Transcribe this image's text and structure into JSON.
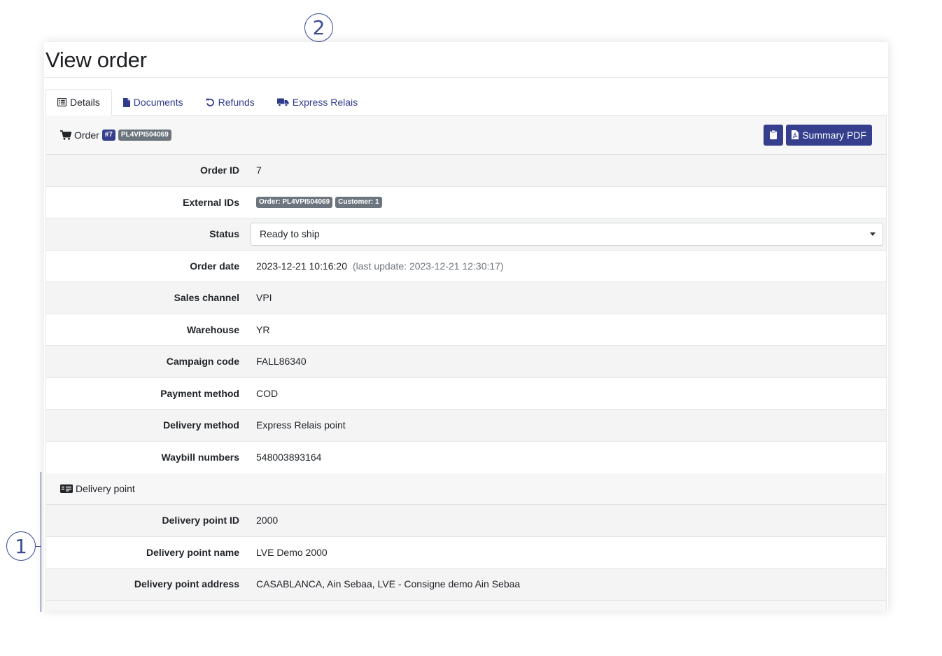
{
  "page": {
    "title": "View order"
  },
  "callouts": {
    "one": "1",
    "two": "2"
  },
  "tabs": [
    {
      "label": "Details",
      "icon": "list-icon"
    },
    {
      "label": "Documents",
      "icon": "file-icon"
    },
    {
      "label": "Refunds",
      "icon": "undo-icon"
    },
    {
      "label": "Express Relais",
      "icon": "truck-icon"
    }
  ],
  "order_header": {
    "label": "Order",
    "number_badge": "#7",
    "reference_badge": "PL4VPI504069",
    "summary_button": "Summary PDF"
  },
  "details": {
    "order_id": {
      "label": "Order ID",
      "value": "7"
    },
    "external_ids": {
      "label": "External IDs",
      "badge_order": "Order: PL4VPI504069",
      "badge_customer": "Customer: 1"
    },
    "status": {
      "label": "Status",
      "selected": "Ready to ship"
    },
    "order_date": {
      "label": "Order date",
      "value": "2023-12-21 10:16:20",
      "last_update": "(last update: 2023-12-21 12:30:17)"
    },
    "sales_channel": {
      "label": "Sales channel",
      "value": "VPI"
    },
    "warehouse": {
      "label": "Warehouse",
      "value": "YR"
    },
    "campaign_code": {
      "label": "Campaign code",
      "value": "FALL86340"
    },
    "payment_method": {
      "label": "Payment method",
      "value": "COD"
    },
    "delivery_method": {
      "label": "Delivery method",
      "value": "Express Relais point"
    },
    "waybill_numbers": {
      "label": "Waybill numbers",
      "value": "548003893164"
    }
  },
  "delivery_point": {
    "section_label": "Delivery point",
    "id": {
      "label": "Delivery point ID",
      "value": "2000"
    },
    "name": {
      "label": "Delivery point name",
      "value": "LVE Demo 2000"
    },
    "address": {
      "label": "Delivery point address",
      "value": "CASABLANCA, Ain Sebaa, LVE - Consigne demo Ain Sebaa"
    }
  },
  "colors": {
    "accent": "#353f8d",
    "badge_gray": "#6c757d",
    "row_alt": "#f4f4f5",
    "callout": "#3a4a94"
  }
}
